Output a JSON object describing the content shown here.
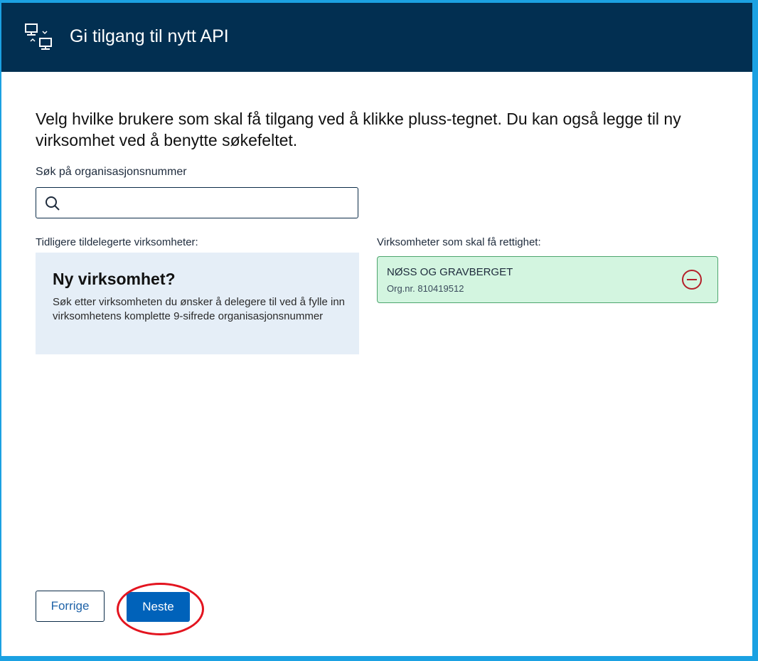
{
  "header": {
    "title": "Gi tilgang til nytt API",
    "icon": "api-delegation-icon"
  },
  "intro": {
    "text": "Velg hvilke brukere som skal få tilgang ved å klikke pluss-tegnet. Du kan også legge til ny virksomhet ved å benytte søkefeltet."
  },
  "search": {
    "label": "Søk på organisasjonsnummer",
    "value": "",
    "placeholder": "",
    "icon": "search-icon"
  },
  "previous_orgs": {
    "label": "Tidligere tildelegerte virksomheter:",
    "empty_title": "Ny virksomhet?",
    "empty_text": "Søk etter virksomheten du ønsker å delegere til ved å fylle inn virksomhetens komplette 9-sifrede organisasjonsnummer"
  },
  "selected_orgs": {
    "label": "Virksomheter som skal få rettighet:",
    "items": [
      {
        "name": "NØSS OG GRAVBERGET",
        "org_nr": "Org.nr. 810419512",
        "action_icon": "remove-circle-icon"
      }
    ]
  },
  "footer": {
    "prev_label": "Forrige",
    "next_label": "Neste"
  },
  "colors": {
    "header_bg": "#022f51",
    "primary": "#0062ba",
    "selected_bg": "#d3f5e0",
    "selected_border": "#4ea56e",
    "remove": "#b4202a",
    "info_bg": "#e5eef7",
    "annotation": "#e3141f"
  }
}
